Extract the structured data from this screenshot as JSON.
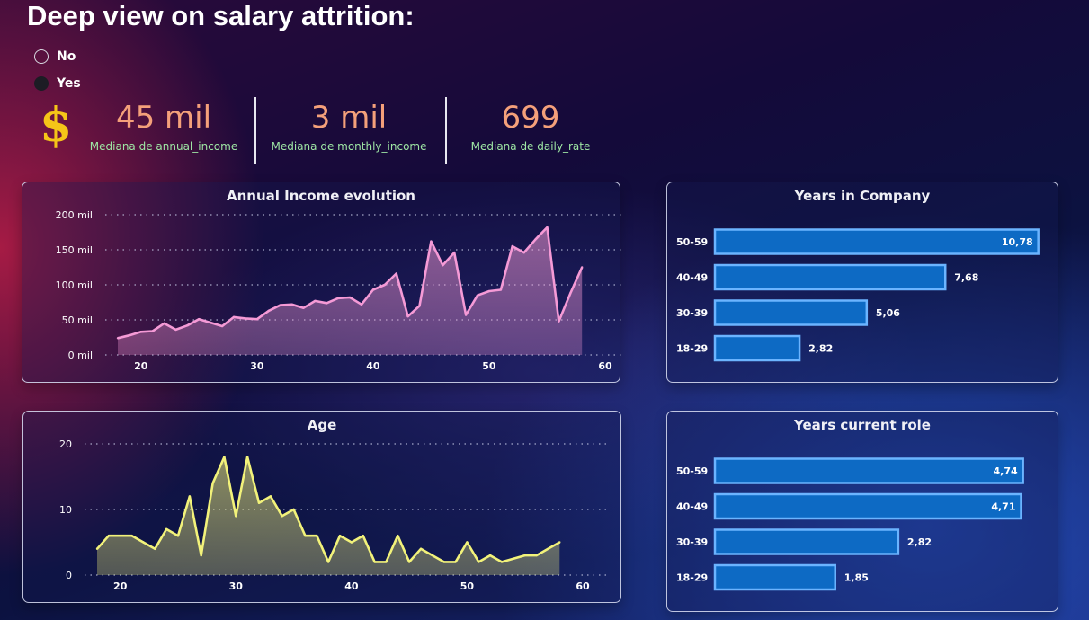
{
  "page": {
    "title": "Deep view on salary attrition:"
  },
  "slicer": {
    "options": [
      {
        "label": "No",
        "selected": false
      },
      {
        "label": "Yes",
        "selected": true
      }
    ]
  },
  "kpis": {
    "icon": "dollar-sign-icon",
    "annual": {
      "value": "45 mil",
      "label": "Mediana de annual_income"
    },
    "monthly": {
      "value": "3 mil",
      "label": "Mediana de monthly_income"
    },
    "daily": {
      "value": "699",
      "label": "Mediana de daily_rate"
    }
  },
  "colors": {
    "income_line": "#f59ad6",
    "age_line": "#f2f27a",
    "bar_fill": "#0d6ac4",
    "bar_stroke": "#6bb4ff",
    "kpi_value": "#f4a07a",
    "kpi_label": "#9ee6a4"
  },
  "chart_data": [
    {
      "id": "annual_income",
      "type": "area",
      "title": "Annual Income evolution",
      "xlabel": "",
      "ylabel": "",
      "xlim": [
        18,
        60
      ],
      "ylim": [
        0,
        200000
      ],
      "x_ticks": [
        20,
        30,
        40,
        50,
        60
      ],
      "y_ticks": [
        {
          "value": 0,
          "label": "0 mil"
        },
        {
          "value": 50000,
          "label": "50 mil"
        },
        {
          "value": 100000,
          "label": "100 mil"
        },
        {
          "value": 150000,
          "label": "150 mil"
        },
        {
          "value": 200000,
          "label": "200 mil"
        }
      ],
      "grid": true,
      "x": [
        18,
        19,
        20,
        21,
        22,
        23,
        24,
        25,
        26,
        27,
        28,
        29,
        30,
        31,
        32,
        33,
        34,
        35,
        36,
        37,
        38,
        39,
        40,
        41,
        42,
        43,
        44,
        45,
        46,
        47,
        48,
        49,
        50,
        51,
        52,
        53,
        54,
        55,
        56,
        57,
        58
      ],
      "values": [
        24000,
        28000,
        33000,
        34000,
        45000,
        36000,
        42000,
        51000,
        46000,
        41000,
        54000,
        52000,
        51000,
        63000,
        71000,
        72000,
        67000,
        77000,
        74000,
        81000,
        82000,
        72000,
        93000,
        100000,
        116000,
        55000,
        70000,
        162000,
        128000,
        146000,
        57000,
        85000,
        91000,
        93000,
        155000,
        146000,
        165000,
        182000,
        48000,
        88000,
        125000
      ]
    },
    {
      "id": "years_in_company",
      "type": "bar",
      "orientation": "horizontal",
      "title": "Years in Company",
      "categories": [
        "50-59",
        "40-49",
        "30-39",
        "18-29"
      ],
      "values": [
        10.78,
        7.68,
        5.06,
        2.82
      ],
      "value_labels": [
        "10,78",
        "7,68",
        "5,06",
        "2,82"
      ],
      "xlim": [
        0,
        11
      ]
    },
    {
      "id": "age",
      "type": "area",
      "title": "Age",
      "xlabel": "",
      "ylabel": "",
      "xlim": [
        18,
        60
      ],
      "ylim": [
        0,
        20
      ],
      "x_ticks": [
        20,
        30,
        40,
        50,
        60
      ],
      "y_ticks": [
        {
          "value": 0,
          "label": "0"
        },
        {
          "value": 10,
          "label": "10"
        },
        {
          "value": 20,
          "label": "20"
        }
      ],
      "grid": true,
      "x": [
        18,
        19,
        20,
        21,
        22,
        23,
        24,
        25,
        26,
        27,
        28,
        29,
        30,
        31,
        32,
        33,
        34,
        35,
        36,
        37,
        38,
        39,
        40,
        41,
        42,
        43,
        44,
        45,
        46,
        47,
        48,
        49,
        50,
        51,
        52,
        53,
        54,
        55,
        56,
        57,
        58
      ],
      "values": [
        4,
        6,
        6,
        6,
        5,
        4,
        7,
        6,
        12,
        3,
        14,
        18,
        9,
        18,
        11,
        12,
        9,
        10,
        6,
        6,
        2,
        6,
        5,
        6,
        2,
        2,
        6,
        2,
        4,
        3,
        2,
        2,
        5,
        2,
        3,
        2,
        2.5,
        3,
        3,
        4,
        5
      ]
    },
    {
      "id": "years_current_role",
      "type": "bar",
      "orientation": "horizontal",
      "title": "Years current role",
      "categories": [
        "50-59",
        "40-49",
        "30-39",
        "18-29"
      ],
      "values": [
        4.74,
        4.71,
        2.82,
        1.85
      ],
      "value_labels": [
        "4,74",
        "4,71",
        "2,82",
        "1,85"
      ],
      "xlim": [
        0,
        4.8
      ]
    }
  ]
}
